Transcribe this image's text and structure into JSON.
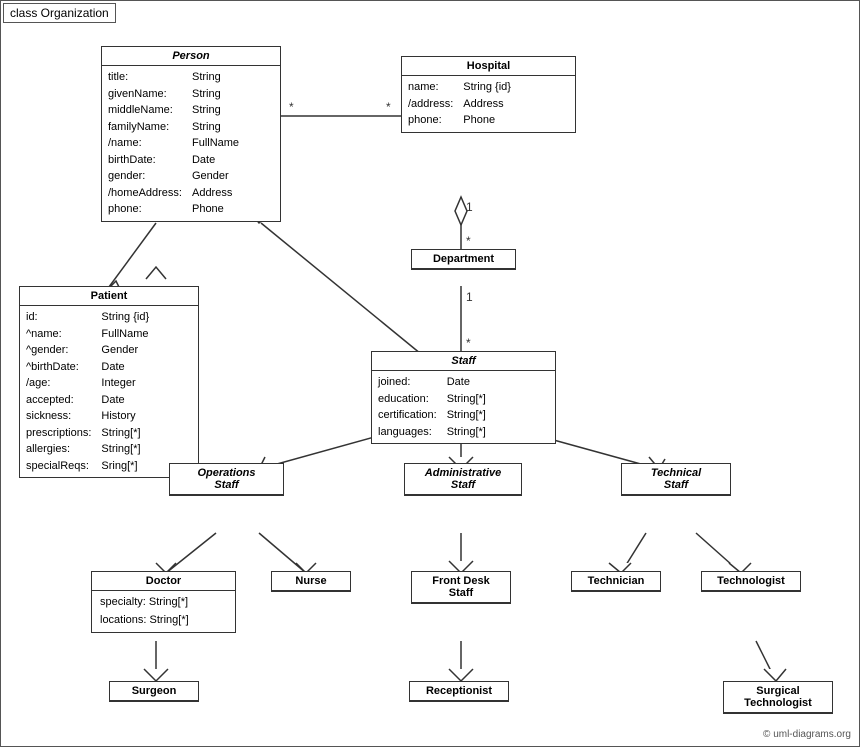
{
  "diagram": {
    "title": "class Organization",
    "copyright": "© uml-diagrams.org",
    "boxes": {
      "person": {
        "name": "Person",
        "italic": true,
        "attrs": [
          "title:",
          "givenName:",
          "middleName:",
          "familyName:",
          "/name:",
          "birthDate:",
          "gender:",
          "/homeAddress:",
          "phone:"
        ],
        "types": [
          "String",
          "String",
          "String",
          "String",
          "FullName",
          "Date",
          "Gender",
          "Address",
          "Phone"
        ]
      },
      "hospital": {
        "name": "Hospital",
        "italic": false,
        "attrs": [
          "name:",
          "/address:",
          "phone:"
        ],
        "types": [
          "String {id}",
          "Address",
          "Phone"
        ]
      },
      "department": {
        "name": "Department",
        "italic": false
      },
      "staff": {
        "name": "Staff",
        "italic": true,
        "attrs": [
          "joined:",
          "education:",
          "certification:",
          "languages:"
        ],
        "types": [
          "Date",
          "String[*]",
          "String[*]",
          "String[*]"
        ]
      },
      "patient": {
        "name": "Patient",
        "italic": false,
        "attrs": [
          "id:",
          "^name:",
          "^gender:",
          "^birthDate:",
          "/age:",
          "accepted:",
          "sickness:",
          "prescriptions:",
          "allergies:",
          "specialReqs:"
        ],
        "types": [
          "String {id}",
          "FullName",
          "Gender",
          "Date",
          "Integer",
          "Date",
          "History",
          "String[*]",
          "String[*]",
          "Sring[*]"
        ]
      },
      "operations_staff": {
        "name": "Operations Staff",
        "italic": true
      },
      "admin_staff": {
        "name": "Administrative Staff",
        "italic": true
      },
      "tech_staff": {
        "name": "Technical Staff",
        "italic": true
      },
      "doctor": {
        "name": "Doctor",
        "attrs": [
          "specialty: String[*]",
          "locations: String[*]"
        ]
      },
      "nurse": {
        "name": "Nurse"
      },
      "front_desk": {
        "name": "Front Desk Staff"
      },
      "technician": {
        "name": "Technician"
      },
      "technologist": {
        "name": "Technologist"
      },
      "surgeon": {
        "name": "Surgeon"
      },
      "receptionist": {
        "name": "Receptionist"
      },
      "surgical_tech": {
        "name": "Surgical Technologist"
      }
    }
  }
}
